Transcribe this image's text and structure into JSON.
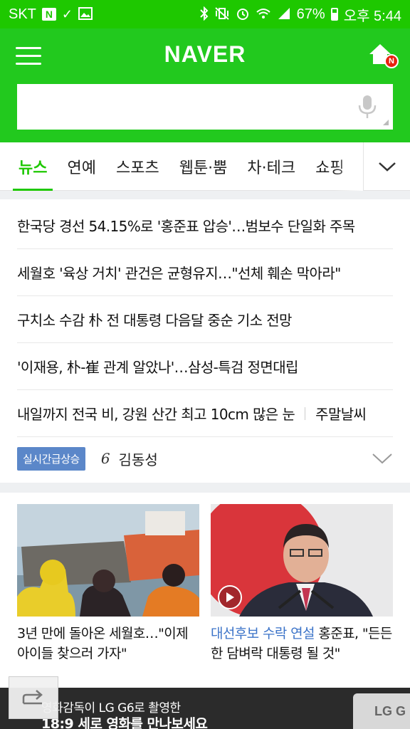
{
  "status_bar": {
    "carrier": "SKT",
    "n_badge": "N",
    "battery": "67%",
    "time": "오후 5:44"
  },
  "header": {
    "logo": "NAVER",
    "home_badge": "N",
    "search": {
      "value": "",
      "placeholder": ""
    }
  },
  "tabs": [
    {
      "label": "뉴스",
      "active": true
    },
    {
      "label": "연예"
    },
    {
      "label": "스포츠"
    },
    {
      "label": "웹툰·뿜"
    },
    {
      "label": "차·테크"
    },
    {
      "label": "쇼핑"
    }
  ],
  "headlines": [
    "한국당 경선 54.15%로 '홍준표 압승'…범보수 단일화 주목",
    "세월호 '육상 거치' 관건은 균형유지…\"선체 훼손 막아라\"",
    "구치소 수감 朴 전 대통령 다음달 중순 기소 전망",
    "'이재용, 朴-崔 관계 알았나'…삼성-특검 정면대립"
  ],
  "headline_last": {
    "text": "내일까지 전국 비, 강원 산간 최고 10cm 많은 눈",
    "related": "주말날씨"
  },
  "trending": {
    "badge": "실시간급상승",
    "rank": "6",
    "keyword": "김동성"
  },
  "cards": [
    {
      "caption": "3년 만에 돌아온 세월호…\"이제 아이들 찾으러 가자\""
    },
    {
      "highlight": "대선후보 수락 연설",
      "caption": "홍준표, \"든든한 담벼락 대통령 될 것\""
    }
  ],
  "ad": {
    "line1": "영화감독이 LG G6로 촬영한",
    "line2": "18:9 세로 영화를 만나보세요",
    "brand": "LG G"
  },
  "colors": {
    "brand_green": "#1ec800",
    "badge_blue": "#5b87c9",
    "highlight_blue": "#3b73c8"
  }
}
